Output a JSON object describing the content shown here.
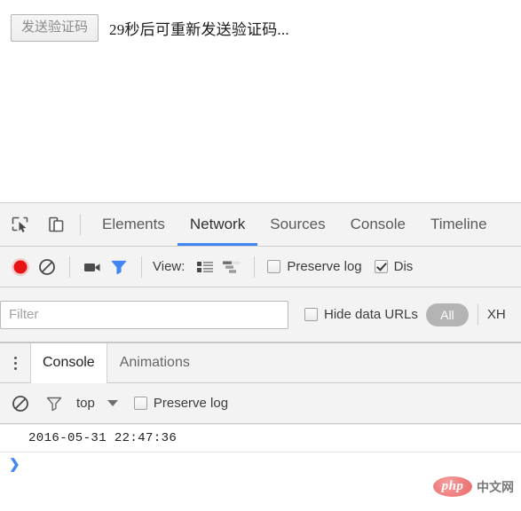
{
  "page": {
    "send_code_button": "发送验证码",
    "countdown_hint": "29秒后可重新发送验证码..."
  },
  "devtools": {
    "toolbar_icons": {
      "inspect": "inspect-element-icon",
      "device": "device-toolbar-icon"
    },
    "tabs": [
      {
        "label": "Elements",
        "active": false
      },
      {
        "label": "Network",
        "active": true
      },
      {
        "label": "Sources",
        "active": false
      },
      {
        "label": "Console",
        "active": false
      },
      {
        "label": "Timeline",
        "active": false
      }
    ],
    "accent_color": "#4285f4",
    "network_toolbar": {
      "record_color": "#e81313",
      "view_label": "View:",
      "preserve_log_label": "Preserve log",
      "preserve_log_checked": false,
      "disable_cache_label": "Dis",
      "disable_cache_checked": true
    },
    "filter_bar": {
      "filter_placeholder": "Filter",
      "filter_value": "",
      "hide_data_urls_label": "Hide data URLs",
      "hide_data_urls_checked": false,
      "type_all": "All",
      "type_xhr": "XH"
    },
    "drawer": {
      "tabs": [
        {
          "label": "Console",
          "active": true
        },
        {
          "label": "Animations",
          "active": false
        }
      ],
      "console_toolbar": {
        "context": "top",
        "preserve_log_label": "Preserve log",
        "preserve_log_checked": false
      },
      "console_messages": [
        "2016-05-31 22:47:36"
      ],
      "prompt_symbol": "❯"
    }
  },
  "watermark": {
    "logo_text": "php",
    "site_text": "中文网"
  }
}
